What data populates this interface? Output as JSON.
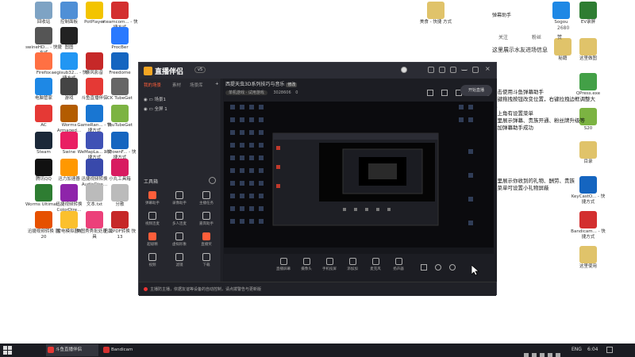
{
  "desktop_icons": [
    {
      "label": "回收站",
      "color": "#7ea3c4"
    },
    {
      "label": "控制面板",
      "color": "#4f8fd6"
    },
    {
      "label": "PotPlayer",
      "color": "#f3c400"
    },
    {
      "label": "steamcom... - 快捷方式",
      "color": "#d32f2f"
    },
    {
      "label": "swineHD... - 快捷方式",
      "color": "#555"
    },
    {
      "label": "图图",
      "color": "#222"
    },
    {
      "label": "ProcBer",
      "color": "#2979ff"
    },
    {
      "label": "Firefox",
      "color": "#ff7043"
    },
    {
      "label": "aegisub32... - 快捷方式",
      "color": "#2196f3"
    },
    {
      "label": "暴风影音",
      "color": "#c62828"
    },
    {
      "label": "Freedome",
      "color": "#1565c0"
    },
    {
      "label": "电脑管家",
      "color": "#1e88e5"
    },
    {
      "label": "游戏",
      "color": "#444"
    },
    {
      "label": "斗鱼直播伴侣",
      "color": "#e53935"
    },
    {
      "label": "CK TubeGet",
      "color": "#666"
    },
    {
      "label": "AC",
      "color": "#e53935"
    },
    {
      "label": "Worms Armaged...",
      "color": "#b35c00"
    },
    {
      "label": "GameRan... - 快捷方式",
      "color": "#1976d2"
    },
    {
      "label": "YouTubeGet",
      "color": "#7cb342"
    },
    {
      "label": "Steam",
      "color": "#1b2838"
    },
    {
      "label": "Swine",
      "color": "#e91e63"
    },
    {
      "label": "WeMapLa... - 快捷方式",
      "color": "#3f51b5"
    },
    {
      "label": "3ilDownF... - 快捷方式",
      "color": "#1565c0"
    },
    {
      "label": "腾讯QQ",
      "color": "#111"
    },
    {
      "label": "迅力加速器",
      "color": "#ff9800"
    },
    {
      "label": "迅捷视频转换 AudioDire...",
      "color": "#3949ab"
    },
    {
      "label": "小丸工具箱",
      "color": "#d81b60"
    },
    {
      "label": "Worms Ultimat...",
      "color": "#2e7d32"
    },
    {
      "label": "迅捷视频转换 ColorDire...",
      "color": "#8e24aa"
    },
    {
      "label": "文本.txt",
      "color": "#bbb"
    },
    {
      "label": "分散",
      "color": "#bbb"
    },
    {
      "label": "迅捷视频转换 器 20",
      "color": "#e65100"
    },
    {
      "label": "雷电模拟器4",
      "color": "#fbc02d"
    },
    {
      "label": "美图秀秀批处理 工具",
      "color": "#ec407a"
    },
    {
      "label": "迅捷PDF转换 快 13",
      "color": "#c62828"
    }
  ],
  "right_icons": [
    {
      "label": "美食 - 快捷 方式",
      "color": "#e0c36a"
    },
    {
      "label": "Sogou",
      "color": "#1e88e5"
    },
    {
      "label": "EV录屏",
      "color": "#2e7d32"
    },
    {
      "label": "秘籍",
      "color": "#e0c36a"
    },
    {
      "label": "这里做图",
      "color": "#e0c36a"
    },
    {
      "label": "QPress.exe",
      "color": "#43a047"
    },
    {
      "label": "S20",
      "color": "#7cb342"
    },
    {
      "label": "目录",
      "color": "#e0c36a"
    },
    {
      "label": "KeyCastO... - 快捷方式",
      "color": "#1565c0"
    },
    {
      "label": "Bandicam... - 快捷方式",
      "color": "#d32f2f"
    },
    {
      "label": "这里使用",
      "color": "#e0c36a"
    }
  ],
  "right_panel": {
    "title": "弹幕助手",
    "row1": [
      "关注",
      "粉丝",
      "赞"
    ],
    "row2": "2680",
    "subtitle": "这里展示水友进场信息"
  },
  "notes": {
    "top": "双击使用斗鱼弹幕助手\n左键拖拽按钮改变位置，右键拉拽边框调整大小\n右上角有设置菜单\n这里展示弹幕、贵族开通、粉丝牌升级等\n添加弹幕助手成功",
    "middle": "这里展示你收到的礼物、酬劳、贵族\n点菜单可设置小礼物屏蔽"
  },
  "window": {
    "app_name": "直播伴侣",
    "version_badge": "v5",
    "sidebar_tabs": [
      "我的场景",
      "素材",
      "场景库"
    ],
    "scenes": [
      "场景1",
      "全屏 1"
    ],
    "tools_label": "工具箱",
    "tools": [
      {
        "label": "弹幕助手",
        "hot": true
      },
      {
        "label": "录像助手",
        "hot": false
      },
      {
        "label": "主播任务",
        "hot": false
      },
      {
        "label": "视频连麦",
        "hot": false
      },
      {
        "label": "多人连麦",
        "hot": false
      },
      {
        "label": "嘉宾助手",
        "hot": false
      },
      {
        "label": "超级精",
        "hot": true
      },
      {
        "label": "虚拟形象",
        "hot": false
      },
      {
        "label": "直播奖",
        "hot": true
      },
      {
        "label": "视频",
        "hot": false
      },
      {
        "label": "滤镜",
        "hot": false
      },
      {
        "label": "下载",
        "hot": false
      }
    ],
    "room_title": "西提天虫3D系列技巧与音乐",
    "room_tag": "修改",
    "room_category": "单机游戏 · 试用游戏",
    "room_id": "3028606",
    "room_hot": "0",
    "bottom_tools": [
      "直播屏幕",
      "摄像头",
      "手机投屏",
      "添加加",
      "麦克风",
      "扬声器"
    ],
    "start_live": "开始直播",
    "status_text": "主播防主播，依据友谊等设备的自动控制，请点拨警告与更新版"
  },
  "taskbar": {
    "tasks": [
      {
        "label": "斗鱼直播伴侣",
        "color": "#e53935"
      },
      {
        "label": "Bandicam",
        "color": "#d32f2f"
      }
    ],
    "lang": "ENG",
    "time": "6:04"
  }
}
